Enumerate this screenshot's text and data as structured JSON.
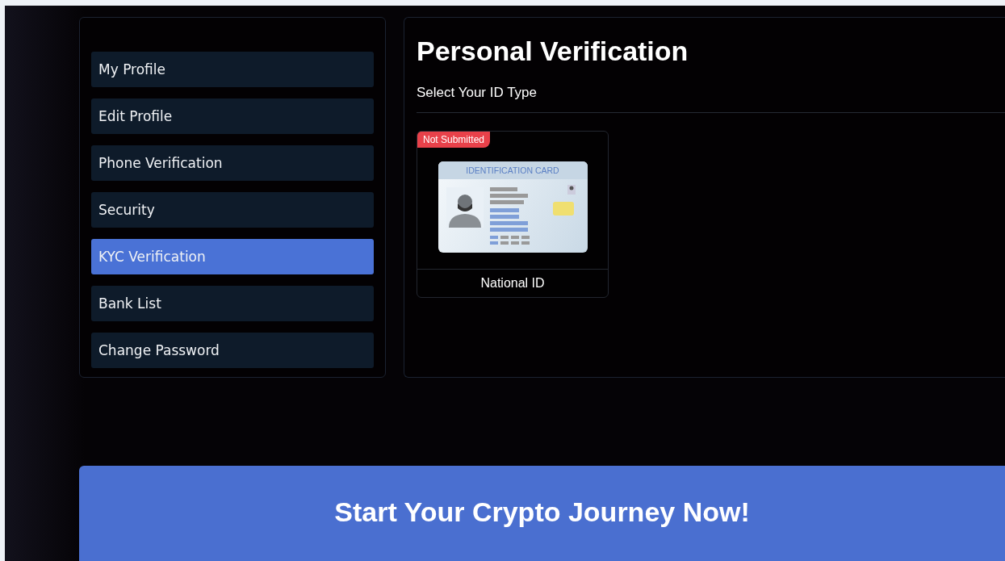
{
  "sidebar": {
    "items": [
      {
        "label": "My Profile",
        "selected": false
      },
      {
        "label": "Edit Profile",
        "selected": false
      },
      {
        "label": "Phone Verification",
        "selected": false
      },
      {
        "label": "Security",
        "selected": false
      },
      {
        "label": "KYC Verification",
        "selected": true
      },
      {
        "label": "Bank List",
        "selected": false
      },
      {
        "label": "Change Password",
        "selected": false
      }
    ]
  },
  "main": {
    "title": "Personal Verification",
    "subtitle": "Select Your ID Type",
    "id_types": [
      {
        "label": "National ID",
        "status": "Not Submitted",
        "card_title": "IDENTIFICATION CARD"
      }
    ]
  },
  "banner": {
    "text": "Start Your Crypto Journey Now!"
  }
}
